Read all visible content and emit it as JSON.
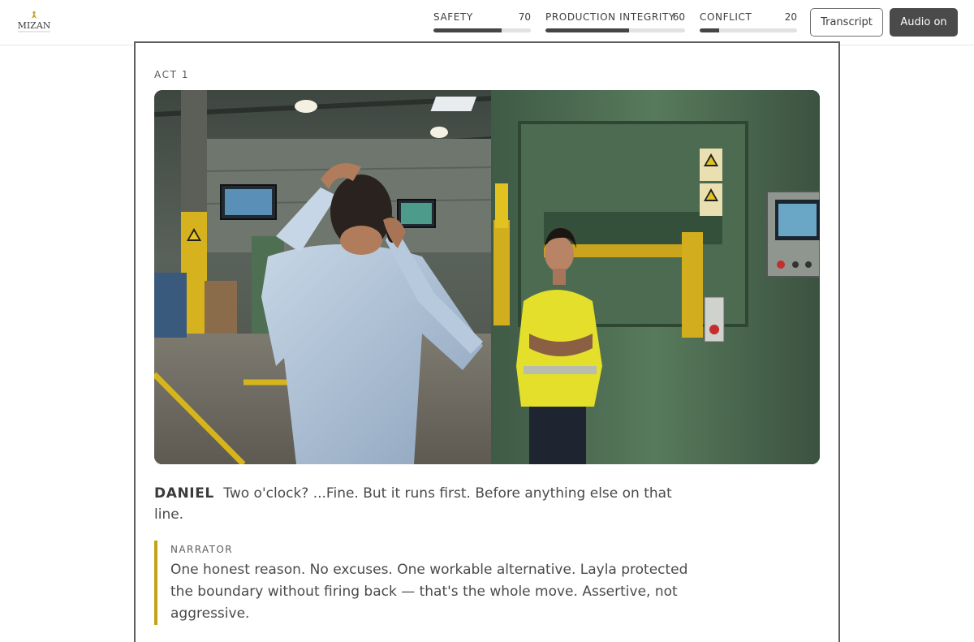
{
  "header": {
    "logo_text": "MIZAN",
    "meters": [
      {
        "label": "SAFETY",
        "value": 70
      },
      {
        "label": "PRODUCTION INTEGRITY",
        "value": 60
      },
      {
        "label": "CONFLICT",
        "value": 20
      }
    ],
    "transcript_label": "Transcript",
    "audio_label": "Audio on"
  },
  "colors": {
    "meter_fill": "#454545",
    "meter_track": "#e2e2e2",
    "narrator_accent": "#c7a116",
    "audio_button_bg": "#4a4a4a"
  },
  "scene": {
    "act_label": "ACT 1",
    "illustration": "factory-floor-scene",
    "dialogue": {
      "speaker": "DANIEL",
      "line": "Two o'clock? ...Fine. But it runs first. Before anything else on that line."
    },
    "narrator": {
      "label": "NARRATOR",
      "text": "One honest reason. No excuses. One workable alternative. Layla protected the boundary without firing back — that's the whole move. Assertive, not aggressive."
    }
  }
}
